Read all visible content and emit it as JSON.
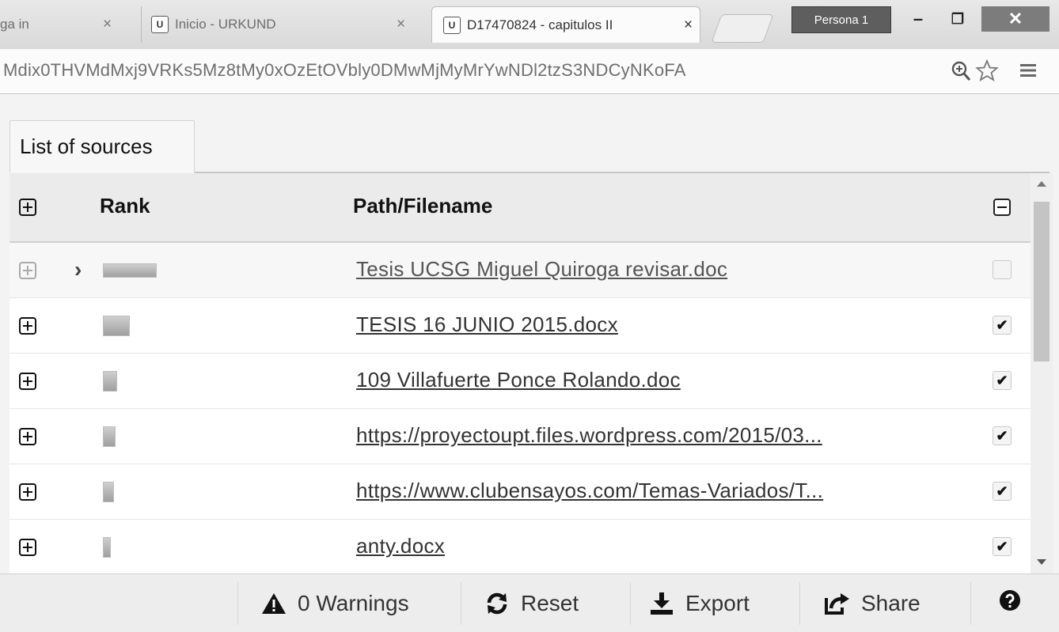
{
  "browser": {
    "tabs": [
      {
        "title": "ga in",
        "favicon": ""
      },
      {
        "title": "Inicio - URKUND",
        "favicon": "U"
      },
      {
        "title": "D17470824 - capitulos II",
        "favicon": "U"
      }
    ],
    "profile_label": "Persona 1",
    "url": "Mdix0THVMdMxj9VRKs5Mz8tMy0xOzEtOVbly0DMwMjMyMrYwNDl2tzS3NDCyNKoFA",
    "icons": {
      "zoom": "zoom-icon",
      "star": "star-icon",
      "menu": "menu-icon"
    }
  },
  "panel": {
    "tab_label": "List of sources",
    "columns": {
      "rank": "Rank",
      "path": "Path/Filename"
    },
    "rows": [
      {
        "path": "Tesis UCSG Miguel Quiroga revisar.doc",
        "checked": false
      },
      {
        "path": "TESIS 16 JUNIO 2015.docx",
        "checked": true
      },
      {
        "path": "109 Villafuerte Ponce Rolando.doc",
        "checked": true
      },
      {
        "path": "https://proyectoupt.files.wordpress.com/2015/03...",
        "checked": true
      },
      {
        "path": "https://www.clubensayos.com/Temas-Variados/T...",
        "checked": true
      },
      {
        "path": "anty.docx",
        "checked": true
      }
    ]
  },
  "footer": {
    "warnings_label": "0 Warnings",
    "reset_label": "Reset",
    "export_label": "Export",
    "share_label": "Share",
    "help_icon": "help-icon"
  },
  "colors": {
    "accent": "#333333",
    "header_bg": "#ebebeb",
    "panel_bg": "#f3f3f3"
  }
}
